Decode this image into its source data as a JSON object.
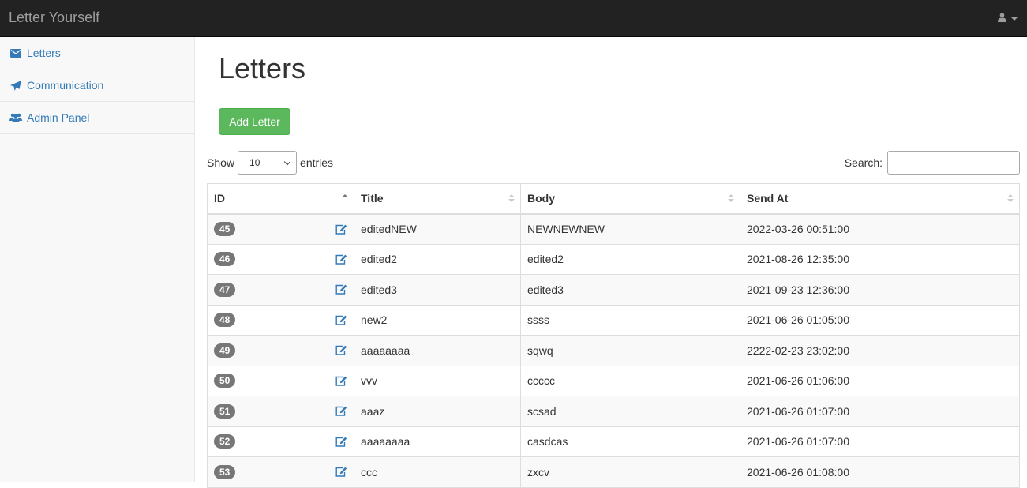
{
  "app": {
    "brand": "Letter Yourself"
  },
  "sidebar": {
    "items": [
      {
        "label": "Letters",
        "icon": "envelope-icon"
      },
      {
        "label": "Communication",
        "icon": "paper-plane-icon"
      },
      {
        "label": "Admin Panel",
        "icon": "users-icon"
      }
    ]
  },
  "main": {
    "title": "Letters",
    "add_button": "Add Letter",
    "length": {
      "show": "Show",
      "value": "10",
      "entries": "entries"
    },
    "search": {
      "label": "Search:",
      "value": ""
    }
  },
  "table": {
    "columns": [
      "ID",
      "Title",
      "Body",
      "Send At"
    ],
    "rows": [
      {
        "id": "45",
        "title": "editedNEW",
        "body": "NEWNEWNEW",
        "send_at": "2022-03-26 00:51:00"
      },
      {
        "id": "46",
        "title": "edited2",
        "body": "edited2",
        "send_at": "2021-08-26 12:35:00"
      },
      {
        "id": "47",
        "title": "edited3",
        "body": "edited3",
        "send_at": "2021-09-23 12:36:00"
      },
      {
        "id": "48",
        "title": "new2",
        "body": "ssss",
        "send_at": "2021-06-26 01:05:00"
      },
      {
        "id": "49",
        "title": "aaaaaaaa",
        "body": "sqwq",
        "send_at": "2222-02-23 23:02:00"
      },
      {
        "id": "50",
        "title": "vvv",
        "body": "ccccc",
        "send_at": "2021-06-26 01:06:00"
      },
      {
        "id": "51",
        "title": "aaaz",
        "body": "scsad",
        "send_at": "2021-06-26 01:07:00"
      },
      {
        "id": "52",
        "title": "aaaaaaaa",
        "body": "casdcas",
        "send_at": "2021-06-26 01:07:00"
      },
      {
        "id": "53",
        "title": "ccc",
        "body": "zxcv",
        "send_at": "2021-06-26 01:08:00"
      }
    ]
  },
  "colors": {
    "navbar": "#222222",
    "link": "#337ab7",
    "success": "#5cb85c",
    "badge": "#777777"
  }
}
